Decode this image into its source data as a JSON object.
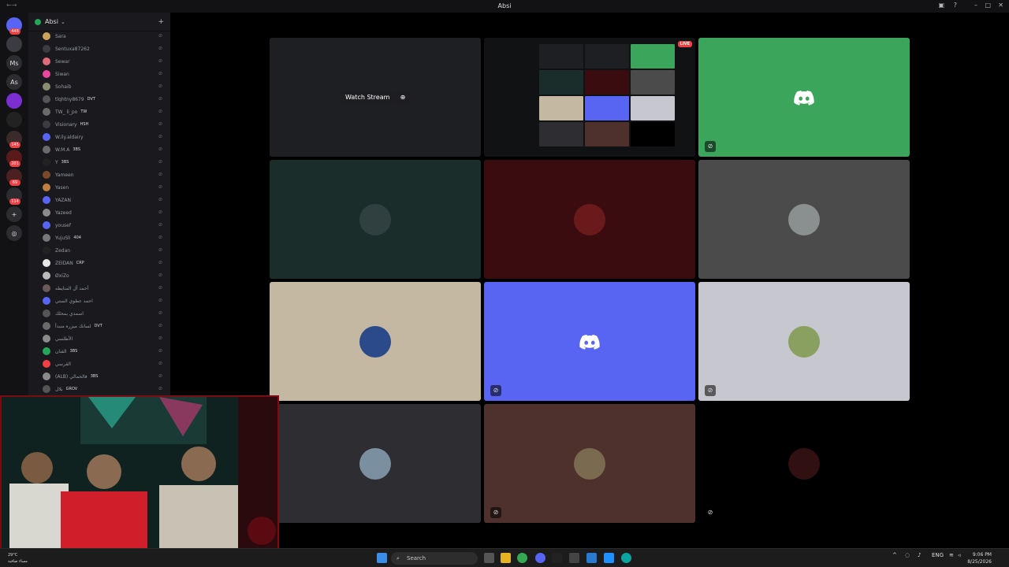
{
  "window": {
    "title": "Absi"
  },
  "servers": [
    {
      "label": "",
      "badge": "448",
      "color": "#5865f2"
    },
    {
      "label": "",
      "badge": "",
      "color": "#3a3c42"
    },
    {
      "label": "Ms",
      "badge": "",
      "color": "#2b2d31"
    },
    {
      "label": "As",
      "badge": "",
      "color": "#2b2d31"
    },
    {
      "label": "",
      "badge": "",
      "color": "#7b2fd0"
    },
    {
      "label": "",
      "badge": "",
      "color": "#222"
    },
    {
      "label": "",
      "badge": "145",
      "color": "#3a2a2a"
    },
    {
      "label": "",
      "badge": "201",
      "color": "#5a1a1a"
    },
    {
      "label": "",
      "badge": "69",
      "color": "#4a2020"
    },
    {
      "label": "",
      "badge": "114",
      "color": "#2b2d31"
    }
  ],
  "guild": {
    "name": "Absi"
  },
  "members": [
    {
      "name": "Sara",
      "tag": "",
      "color": "#c9a25c"
    },
    {
      "name": "Sentuxa87262",
      "tag": "",
      "color": "#3a3c42"
    },
    {
      "name": "Sewar",
      "tag": "",
      "color": "#e06a7a"
    },
    {
      "name": "Siwan",
      "tag": "",
      "color": "#eb459e"
    },
    {
      "name": "Sohaib",
      "tag": "",
      "color": "#8b8b70"
    },
    {
      "name": "tlqhtny8679",
      "tag": "DVT",
      "color": "#555"
    },
    {
      "name": "TW_ li_po",
      "tag": "TW",
      "color": "#6a6a6a"
    },
    {
      "name": "Visionary",
      "tag": "HSH",
      "color": "#3a3c42"
    },
    {
      "name": "W.ily.aldairy",
      "tag": "",
      "color": "#5865f2"
    },
    {
      "name": "W.M.A",
      "tag": "3BS",
      "color": "#6a6a6a"
    },
    {
      "name": "Y",
      "tag": "3BS",
      "color": "#222"
    },
    {
      "name": "Yameen",
      "tag": "",
      "color": "#7a4a2a"
    },
    {
      "name": "Yasen",
      "tag": "",
      "color": "#c08040"
    },
    {
      "name": "YAZAN",
      "tag": "",
      "color": "#5865f2"
    },
    {
      "name": "Yazeed",
      "tag": "",
      "color": "#8a8a8a"
    },
    {
      "name": "yousef",
      "tag": "",
      "color": "#5865f2"
    },
    {
      "name": "YujuSli",
      "tag": "404",
      "color": "#777"
    },
    {
      "name": "Zedan",
      "tag": "",
      "color": "#222"
    },
    {
      "name": "ZEIDAN",
      "tag": "CRP",
      "color": "#e6e6e6"
    },
    {
      "name": "ØxiZo",
      "tag": "",
      "color": "#bbbbbb"
    },
    {
      "name": "أحمد آل المنايطه",
      "tag": "",
      "color": "#6a5a5a"
    },
    {
      "name": "احمد عطوي الستي",
      "tag": "",
      "color": "#5865f2"
    },
    {
      "name": "اسمدي بمحلك",
      "tag": "",
      "color": "#555"
    },
    {
      "name": "لسانك ميزره منبدأ",
      "tag": "DVT",
      "color": "#6a6a6a"
    },
    {
      "name": "الأطلسي",
      "tag": "",
      "color": "#8a8a8a"
    },
    {
      "name": "الفنان",
      "tag": "3BS",
      "color": "#23a55a"
    },
    {
      "name": "القرسي",
      "tag": "",
      "color": "#f23f43"
    },
    {
      "name": "(ALB) فالحمالي",
      "tag": "3BS",
      "color": "#8a8a8a"
    },
    {
      "name": "بلال",
      "tag": "GROV",
      "color": "#555"
    }
  ],
  "stream": {
    "watch_label": "Watch Stream",
    "live_label": "LIVE"
  },
  "tiles": [
    {
      "kind": "stream",
      "bg": "#1d1f22"
    },
    {
      "kind": "live",
      "bg": "#111214"
    },
    {
      "kind": "discord",
      "bg": "#3ba55c",
      "muted": true
    },
    {
      "kind": "avatar",
      "bg": "#1b2d2a",
      "avatar": "#304040"
    },
    {
      "kind": "avatar",
      "bg": "#3a0c0f",
      "avatar": "#6a1a1a"
    },
    {
      "kind": "avatar",
      "bg": "#4b4b4b",
      "avatar": "#8a8f90"
    },
    {
      "kind": "avatar",
      "bg": "#c4b8a3",
      "avatar": "#2a4a8a"
    },
    {
      "kind": "discord",
      "bg": "#5865f2",
      "muted": true
    },
    {
      "kind": "avatar",
      "bg": "#c7c7cf",
      "avatar": "#8aa060",
      "muted": true
    },
    {
      "kind": "avatar",
      "bg": "#2e2d31",
      "avatar": "#7a8fa0"
    },
    {
      "kind": "avatar",
      "bg": "#4e302c",
      "avatar": "#7a6a50",
      "muted": true
    },
    {
      "kind": "avatar",
      "bg": "#000000",
      "avatar": "#301010",
      "muted": true
    }
  ],
  "taskbar": {
    "search_placeholder": "Search",
    "weather": [
      "29°C",
      "مساء صافية"
    ],
    "lang": "ENG",
    "time": "9:06 PM",
    "date": "8/25/2026"
  }
}
